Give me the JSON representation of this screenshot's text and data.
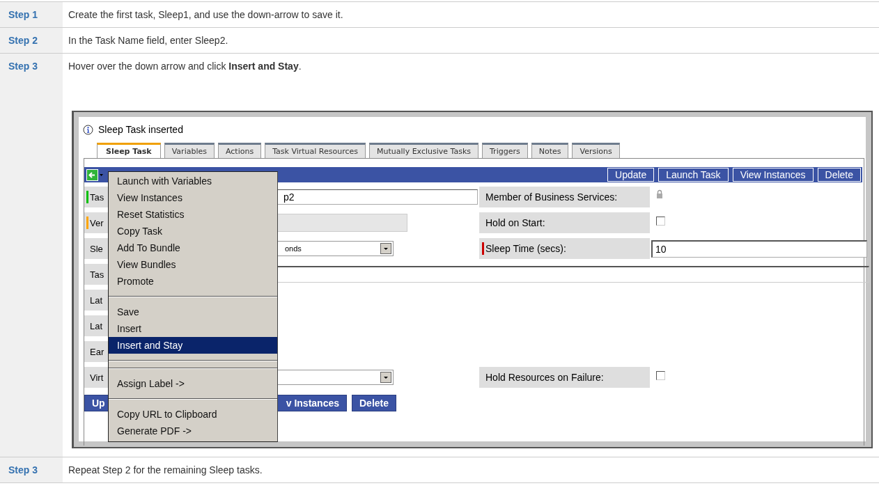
{
  "steps": [
    {
      "label": "Step 1",
      "text": "Create the first task, Sleep1, and use the down-arrow to save it."
    },
    {
      "label": "Step 2",
      "text": "In the Task Name field, enter Sleep2."
    },
    {
      "label": "Step 3",
      "text": "Hover over the down arrow and click **Insert and Stay**.",
      "screenshot": {
        "message": "Sleep Task inserted",
        "tabs": [
          {
            "label": "Sleep Task",
            "selected": true
          },
          {
            "label": "Variables",
            "selected": false
          },
          {
            "label": "Actions",
            "selected": false
          },
          {
            "label": "Task Virtual Resources",
            "selected": false
          },
          {
            "label": "Mutually Exclusive Tasks",
            "selected": false
          },
          {
            "label": "Triggers",
            "selected": false
          },
          {
            "label": "Notes",
            "selected": false
          },
          {
            "label": "Versions",
            "selected": false
          }
        ],
        "toolbar_buttons": [
          "Update",
          "Launch Task",
          "View Instances",
          "Delete"
        ],
        "rows": [
          {
            "label": "Tas",
            "color": "#00c000",
            "field": {
              "kind": "text",
              "value": "p2"
            },
            "right": {
              "label": "Member of Business Services:",
              "kind": "lock"
            }
          },
          {
            "label": "Ver",
            "color": "#ffa500",
            "field": {
              "kind": "disabled"
            },
            "right": {
              "label": "Hold on Start:",
              "kind": "checkbox",
              "checked": false
            }
          },
          {
            "label": "Sle",
            "field": {
              "kind": "select",
              "value": "onds"
            },
            "right": {
              "label": "Sleep Time (secs):",
              "kind": "input",
              "color": "#cc0000",
              "value": "10"
            }
          },
          {
            "label": "Tas",
            "field": {
              "kind": "wide"
            }
          },
          {
            "label": "Lat"
          },
          {
            "label": "Lat"
          },
          {
            "label": "Ear"
          },
          {
            "label": "Virt",
            "field": {
              "kind": "select"
            },
            "right": {
              "label": "Hold Resources on Failure:",
              "kind": "checkbox",
              "checked": false
            }
          }
        ],
        "bottom_buttons": [
          "Up",
          "v Instances",
          "Delete"
        ],
        "menu": [
          {
            "kind": "item",
            "label": "Launch with Variables",
            "selected": false
          },
          {
            "kind": "item",
            "label": "View Instances",
            "selected": false
          },
          {
            "kind": "item",
            "label": "Reset Statistics",
            "selected": false
          },
          {
            "kind": "item",
            "label": "Copy Task",
            "selected": false
          },
          {
            "kind": "item",
            "label": "Add To Bundle",
            "selected": false
          },
          {
            "kind": "item",
            "label": "View Bundles",
            "selected": false
          },
          {
            "kind": "item",
            "label": "Promote",
            "selected": false
          },
          {
            "kind": "separator"
          },
          {
            "kind": "item",
            "label": "Save",
            "selected": false
          },
          {
            "kind": "item",
            "label": "Insert",
            "selected": false
          },
          {
            "kind": "item",
            "label": "Insert and Stay",
            "selected": true
          },
          {
            "kind": "separator"
          },
          {
            "kind": "separator"
          },
          {
            "kind": "item",
            "label": "Assign Label ->",
            "selected": false
          },
          {
            "kind": "separator"
          },
          {
            "kind": "item",
            "label": "Copy URL to Clipboard",
            "selected": false
          },
          {
            "kind": "item",
            "label": "Generate PDF ->",
            "selected": false
          }
        ]
      }
    },
    {
      "label": "Step 3",
      "text": "Repeat Step 2 for the remaining Sleep tasks."
    }
  ]
}
